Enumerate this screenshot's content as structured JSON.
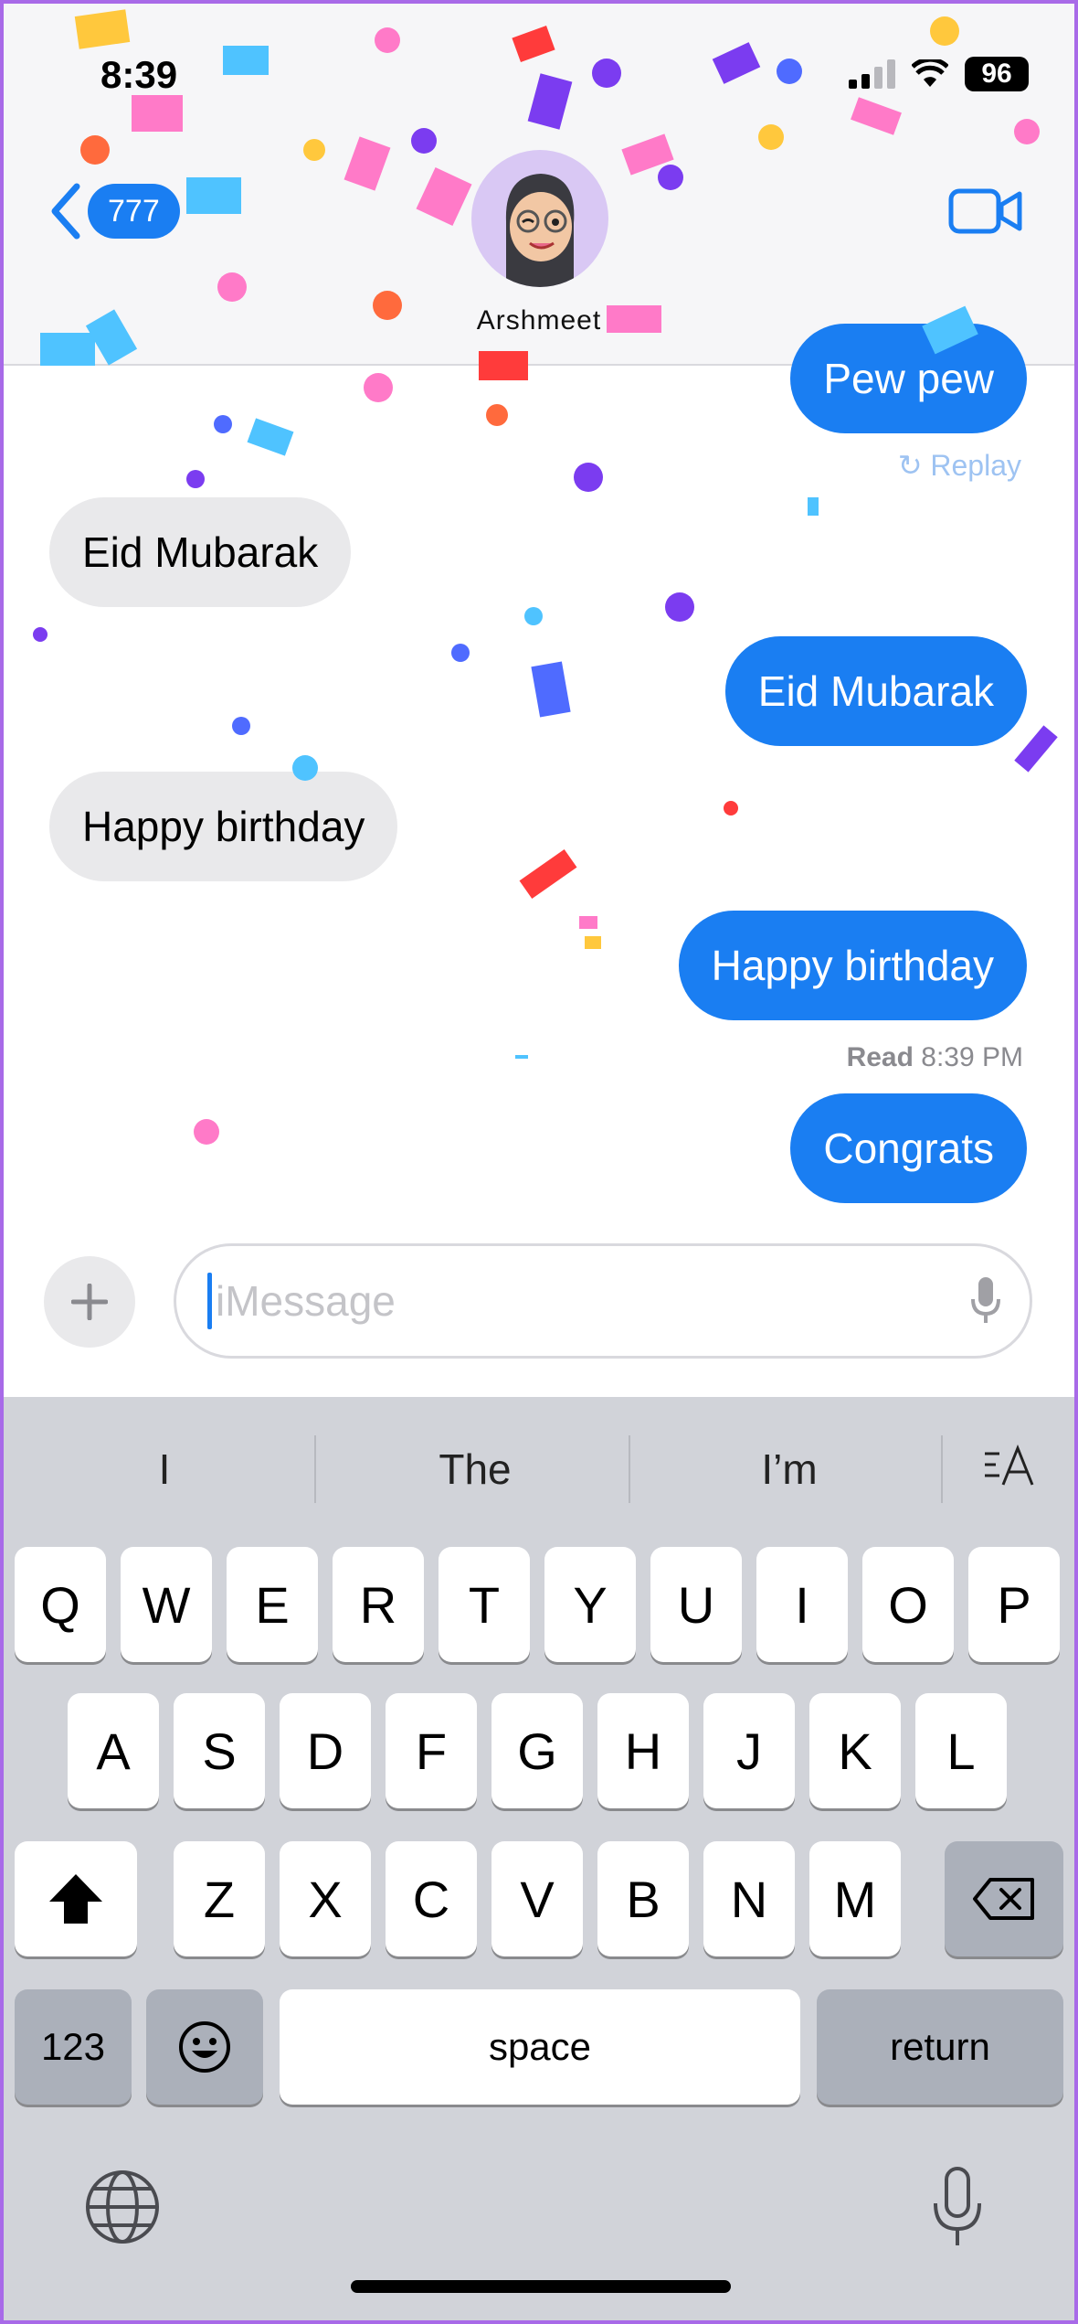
{
  "status_bar": {
    "time": "8:39",
    "battery": "96"
  },
  "header": {
    "back_count": "777",
    "contact_name": "Arshmeet"
  },
  "messages": [
    {
      "dir": "out",
      "text": "Pew pew"
    },
    {
      "dir": "in",
      "text": "Eid Mubarak"
    },
    {
      "dir": "out",
      "text": "Eid Mubarak"
    },
    {
      "dir": "in",
      "text": "Happy birthday"
    },
    {
      "dir": "out",
      "text": "Happy birthday"
    },
    {
      "dir": "out",
      "text": "Congrats"
    }
  ],
  "replay_label": "Replay",
  "read_receipt": {
    "label": "Read",
    "time": "8:39 PM"
  },
  "compose": {
    "placeholder": "iMessage"
  },
  "keyboard": {
    "suggestions": [
      "I",
      "The",
      "I’m"
    ],
    "row1": [
      "Q",
      "W",
      "E",
      "R",
      "T",
      "Y",
      "U",
      "I",
      "O",
      "P"
    ],
    "row2": [
      "A",
      "S",
      "D",
      "F",
      "G",
      "H",
      "J",
      "K",
      "L"
    ],
    "row3": [
      "Z",
      "X",
      "C",
      "V",
      "B",
      "N",
      "M"
    ],
    "numbers_key": "123",
    "space_key": "space",
    "return_key": "return"
  },
  "colors": {
    "accent": "#1a7ef2",
    "incoming_bubble": "#e9e9eb",
    "keyboard_bg": "#d1d3d9"
  }
}
